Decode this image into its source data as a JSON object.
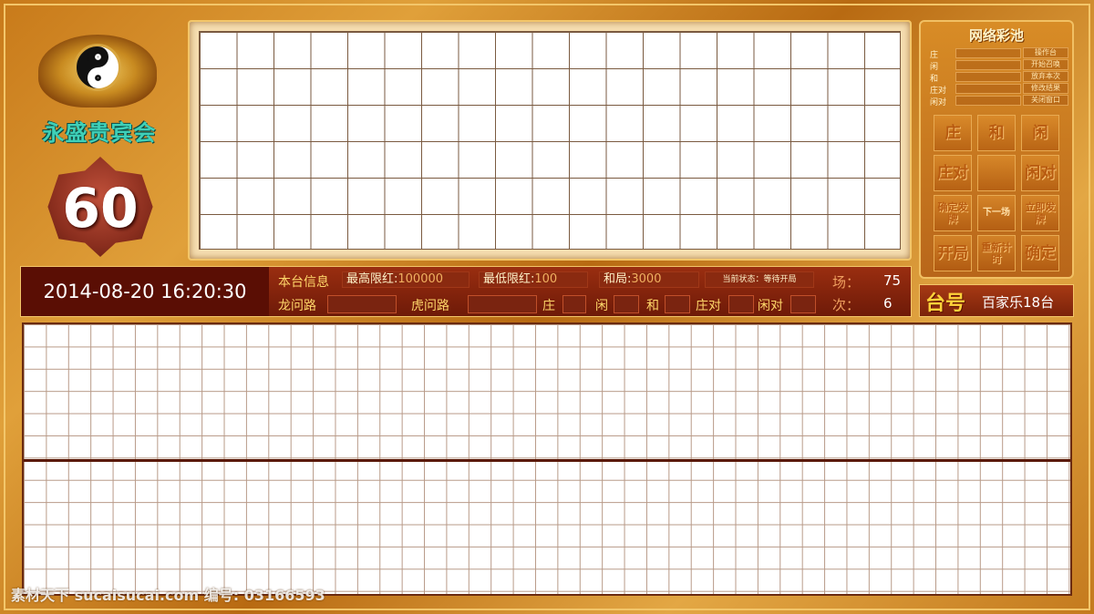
{
  "brand": {
    "name": "永盛贵宾会"
  },
  "countdown": {
    "value": "60"
  },
  "right_panel": {
    "title": "网络彩池",
    "rows": [
      {
        "label": "庄",
        "button": "操作台"
      },
      {
        "label": "闲",
        "button": "开始召唤"
      },
      {
        "label": "和",
        "button": "放弃本次"
      },
      {
        "label": "庄对",
        "button": "修改结果"
      },
      {
        "label": "闲对",
        "button": "关闭窗口"
      }
    ],
    "bets": {
      "banker": "庄",
      "tie": "和",
      "player": "闲",
      "banker_pair": "庄对",
      "player_pair": "闲对",
      "confirm_deal": "确定发牌",
      "next_round": "下一场",
      "deal_now": "立即发牌",
      "open_round": "开局",
      "reset_timer": "重新计时",
      "confirm": "确定"
    }
  },
  "info_bar": {
    "datetime": "2014-08-20 16:20:30",
    "table_info_label": "本台信息",
    "max_limit_label": "最高限红:",
    "max_limit_value": "100000",
    "min_limit_label": "最低限红:",
    "min_limit_value": "100",
    "tie_label": "和局:",
    "tie_value": "3000",
    "status": "当前状态：等待开局",
    "dragon_road": "龙问路",
    "tiger_road": "虎问路",
    "banker": "庄",
    "player": "闲",
    "tie": "和",
    "banker_pair": "庄对",
    "player_pair": "闲对",
    "field_label": "场：",
    "field_value": "75",
    "round_label": "次：",
    "round_value": "6"
  },
  "table_number": {
    "label": "台号",
    "value": "百家乐18台"
  },
  "watermark": "素材天下 sucaisucai.com   编号: 03166593"
}
